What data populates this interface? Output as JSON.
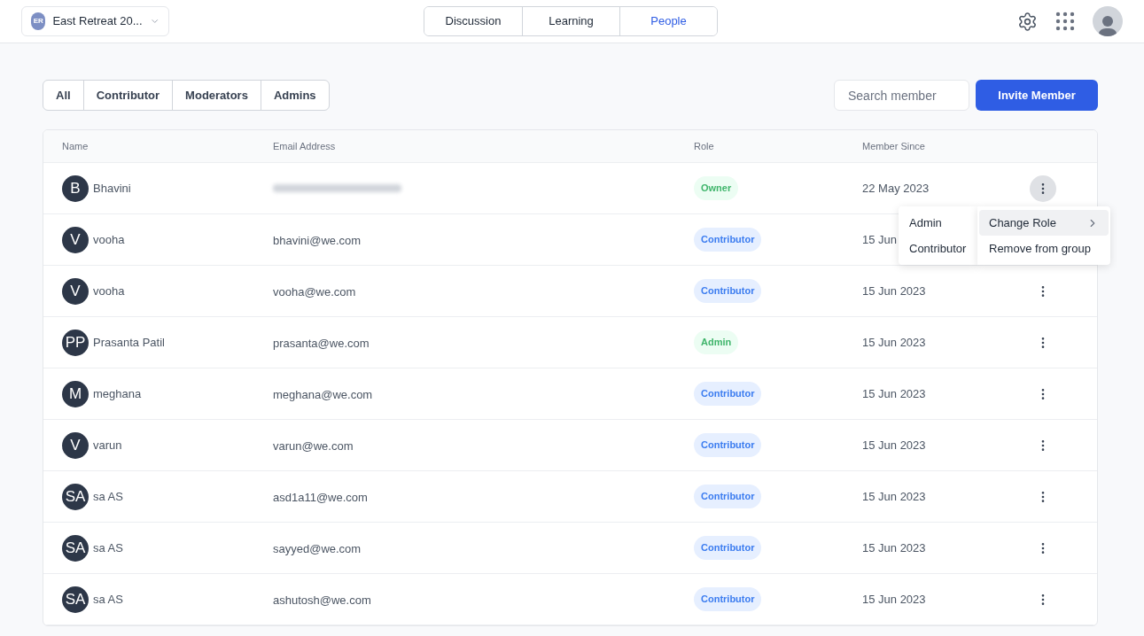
{
  "group_selector": {
    "initials": "ER",
    "name": "East Retreat 20..."
  },
  "nav_tabs": [
    {
      "label": "Discussion",
      "selected": false
    },
    {
      "label": "Learning",
      "selected": false
    },
    {
      "label": "People",
      "selected": true
    }
  ],
  "filters": [
    {
      "label": "All",
      "selected": false
    },
    {
      "label": "Contributor",
      "selected": false
    },
    {
      "label": "Moderators",
      "selected": false
    },
    {
      "label": "Admins",
      "selected": false
    }
  ],
  "search": {
    "placeholder": "Search member"
  },
  "invite_button": "Invite Member",
  "table": {
    "columns": [
      "Name",
      "Email Address",
      "Role",
      "Member Since"
    ],
    "rows": [
      {
        "initials": "B",
        "name": "Bhavini",
        "email_blurred": true,
        "role": "Owner",
        "kind": "owner",
        "since": "22 May 2023",
        "menu_open": true
      },
      {
        "initials": "V",
        "name": "vooha",
        "email": "bhavini@we.com",
        "role": "Contributor",
        "kind": "contributor",
        "since": "15 Jun"
      },
      {
        "initials": "V",
        "name": "vooha",
        "email": "vooha@we.com",
        "role": "Contributor",
        "kind": "contributor",
        "since": "15 Jun 2023",
        "menu_open": false
      },
      {
        "initials": "PP",
        "name": "Prasanta Patil",
        "email": "prasanta@we.com",
        "role": "Admin",
        "kind": "admin",
        "since": "15 Jun 2023",
        "menu_open": false
      },
      {
        "initials": "M",
        "name": "meghana",
        "email": "meghana@we.com",
        "role": "Contributor",
        "kind": "contributor",
        "since": "15 Jun 2023",
        "menu_open": false
      },
      {
        "initials": "V",
        "name": "varun",
        "email": "varun@we.com",
        "role": "Contributor",
        "kind": "contributor",
        "since": "15 Jun 2023",
        "menu_open": false
      },
      {
        "initials": "SA",
        "name": "sa AS",
        "email": "asd1a11@we.com",
        "role": "Contributor",
        "kind": "contributor",
        "since": "15 Jun 2023",
        "menu_open": false
      },
      {
        "initials": "SA",
        "name": "sa AS",
        "email": "sayyed@we.com",
        "role": "Contributor",
        "kind": "contributor",
        "since": "15 Jun 2023",
        "menu_open": false
      },
      {
        "initials": "SA",
        "name": "sa AS",
        "email": "ashutosh@we.com",
        "role": "Contributor",
        "kind": "contributor",
        "since": "15 Jun 2023",
        "menu_open": false
      }
    ]
  },
  "context_menu": {
    "submenu": [
      {
        "label": "Admin"
      },
      {
        "label": "Contributor"
      }
    ],
    "items": [
      {
        "label": "Change Role",
        "kind": "submenu",
        "selected": true
      },
      {
        "label": "Remove from group",
        "kind": "action",
        "selected": false
      }
    ]
  }
}
